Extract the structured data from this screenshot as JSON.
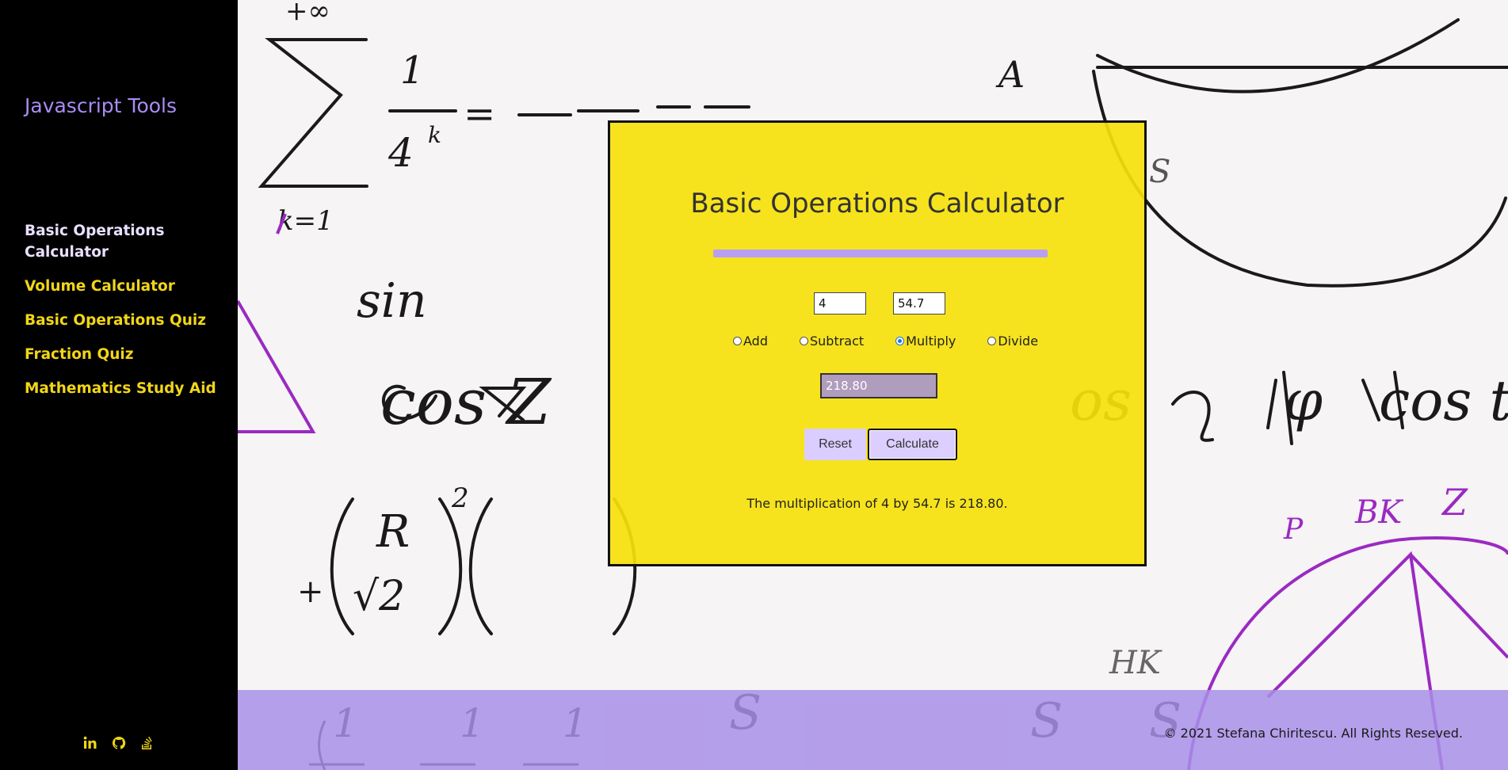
{
  "sidebar": {
    "brand": "Javascript Tools",
    "nav": [
      {
        "label": "Basic Operations Calculator",
        "active": true
      },
      {
        "label": "Volume Calculator",
        "active": false
      },
      {
        "label": "Basic Operations Quiz",
        "active": false
      },
      {
        "label": "Fraction Quiz",
        "active": false
      },
      {
        "label": "Mathematics Study Aid",
        "active": false
      }
    ],
    "social_icons": [
      "linkedin-icon",
      "github-icon",
      "stackoverflow-icon"
    ]
  },
  "calculator": {
    "title": "Basic Operations Calculator",
    "input_a": "4",
    "input_b": "54.7",
    "operations": [
      {
        "label": "Add",
        "checked": false
      },
      {
        "label": "Subtract",
        "checked": false
      },
      {
        "label": "Multiply",
        "checked": true
      },
      {
        "label": "Divide",
        "checked": false
      }
    ],
    "result": "218.80",
    "reset_label": "Reset",
    "calculate_label": "Calculate",
    "message": "The multiplication of 4 by 54.7 is 218.80."
  },
  "footer": {
    "copyright": "© 2021 Stefana Chiritescu. All Rights Reseved."
  },
  "colors": {
    "sidebar_bg": "#000000",
    "brand": "#a98cf2",
    "nav_link": "#f2d617",
    "card_bg": "#f5e10a",
    "accent_purple": "#b7a0f3",
    "footer_bg": "#a88fe8"
  }
}
